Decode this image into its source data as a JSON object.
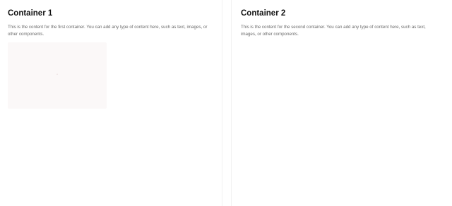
{
  "containers": [
    {
      "title": "Container 1",
      "content": "This is the content for the first container. You can add any type of content here, such as text, images, or other components."
    },
    {
      "title": "Container 2",
      "content": "This is the content for the second container. You can add any type of content here, such as text, images, or other components."
    }
  ],
  "media": {
    "icon": "image-placeholder-icon"
  }
}
